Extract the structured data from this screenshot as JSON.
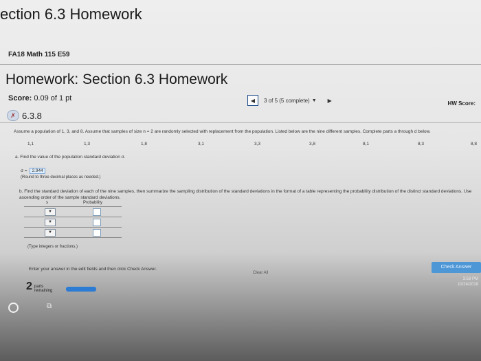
{
  "window": {
    "tab_title": "ection 6.3 Homework"
  },
  "course": "FA18 Math 115 E59",
  "homework": {
    "title": "Homework: Section 6.3 Homework"
  },
  "score": {
    "label": "Score:",
    "value": "0.09 of 1 pt"
  },
  "navigation": {
    "prev_icon": "triangle-left-icon",
    "status": "3 of 5 (5 complete)",
    "dropdown_icon": "triangle-down-icon",
    "next_icon": "triangle-right-icon"
  },
  "hw_score": {
    "label": "HW Score:"
  },
  "question": {
    "id": "6.3.8",
    "status_icon": "partial-credit-icon"
  },
  "problem": {
    "prompt": "Assume a population of 1, 3, and 8. Assume that samples of size n = 2 are randomly selected with replacement from the population. Listed below are the nine different samples. Complete parts a through d below.",
    "samples": [
      "1,1",
      "1,3",
      "1,8",
      "3,1",
      "3,3",
      "3,8",
      "8,1",
      "8,3",
      "8,8"
    ]
  },
  "part_a": {
    "text": "a. Find the value of the population standard deviation σ.",
    "sigma_label": "σ =",
    "sigma_value": "2.944",
    "rounding_note": "(Round to three decimal places as needed.)"
  },
  "part_b": {
    "text_line1": "b. Find the standard deviation of each of the nine samples, then summarize the sampling distribution of the standard deviations in the format of a table representing the probability distribution of the distinct standard deviations. Use",
    "text_line2": "ascending order of the sample standard deviations.",
    "table": {
      "col_s": "s",
      "col_prob": "Probability",
      "rows": 3,
      "dropdown_icon": "triangle-down-icon"
    },
    "note": "(Type integers or fractions.)"
  },
  "footer": {
    "hint": "Enter your answer in the edit fields and then click Check Answer.",
    "clear_all": "Clear All",
    "check_answer": "Check Answer",
    "parts_count": "2",
    "parts_label_1": "parts",
    "parts_label_2": "remaining",
    "progress_fraction": 0.5
  },
  "taskbar": {
    "start_icon": "cortana-circle-icon",
    "taskview_icon": "task-view-icon",
    "time": "3:58 PM",
    "date": "10/24/2018"
  }
}
